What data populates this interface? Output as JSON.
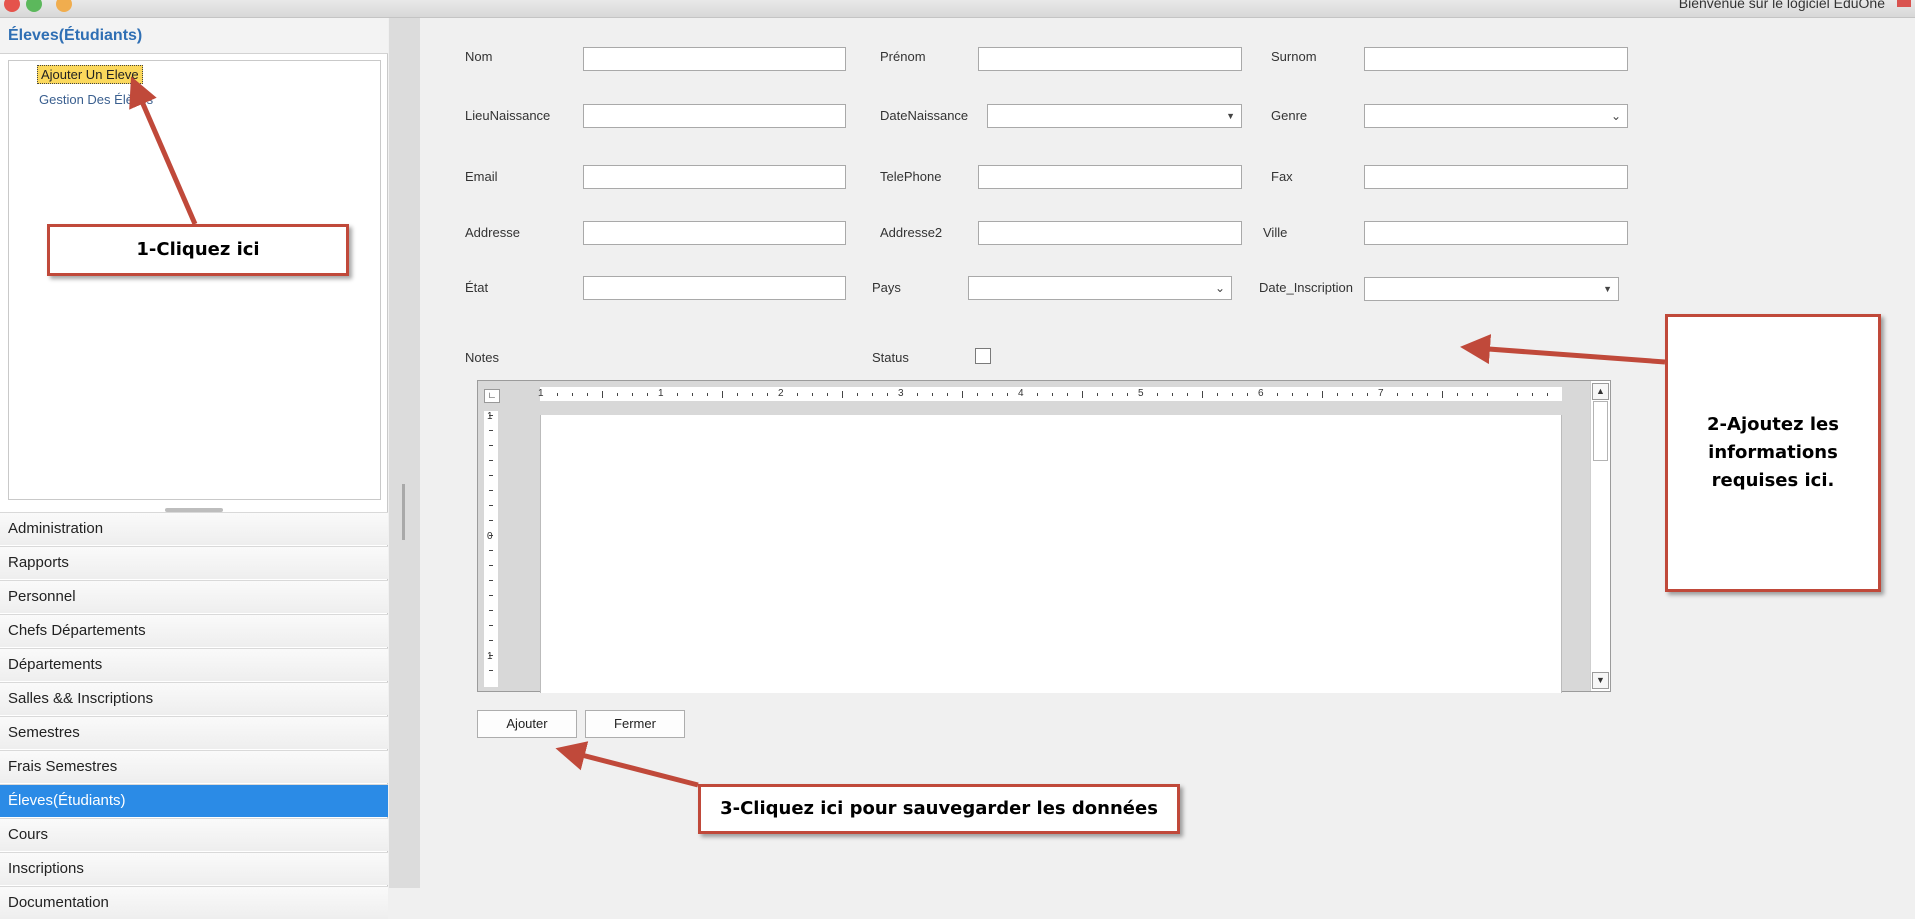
{
  "window": {
    "welcome_text": "Bienvenue sur le logiciel EduOne"
  },
  "sidebar": {
    "group_title": "Éleves(Étudiants)",
    "tree_items": [
      {
        "label": "Ajouter Un Eleve",
        "selected": true
      },
      {
        "label": "Gestion Des Élèves",
        "selected": false
      }
    ],
    "nav_items": [
      {
        "label": "Administration"
      },
      {
        "label": "Rapports"
      },
      {
        "label": "Personnel"
      },
      {
        "label": "Chefs Départements"
      },
      {
        "label": "Départements"
      },
      {
        "label": "Salles && Inscriptions"
      },
      {
        "label": "Semestres"
      },
      {
        "label": "Frais Semestres"
      },
      {
        "label": "Éleves(Étudiants)",
        "active": true
      },
      {
        "label": "Cours"
      },
      {
        "label": "Inscriptions"
      },
      {
        "label": "Documentation"
      }
    ]
  },
  "form": {
    "nom": {
      "label": "Nom",
      "value": ""
    },
    "prenom": {
      "label": "Prénom",
      "value": ""
    },
    "surnom": {
      "label": "Surnom",
      "value": ""
    },
    "lieu_naissance": {
      "label": "LieuNaissance",
      "value": ""
    },
    "date_naissance": {
      "label": "DateNaissance",
      "value": ""
    },
    "genre": {
      "label": "Genre",
      "value": ""
    },
    "email": {
      "label": "Email",
      "value": ""
    },
    "telephone": {
      "label": "TelePhone",
      "value": ""
    },
    "fax": {
      "label": "Fax",
      "value": ""
    },
    "addresse": {
      "label": "Addresse",
      "value": ""
    },
    "addresse2": {
      "label": "Addresse2",
      "value": ""
    },
    "ville": {
      "label": "Ville",
      "value": ""
    },
    "etat": {
      "label": "État",
      "value": ""
    },
    "pays": {
      "label": "Pays",
      "value": ""
    },
    "date_inscription": {
      "label": "Date_Inscription",
      "value": ""
    },
    "notes": {
      "label": "Notes"
    },
    "status": {
      "label": "Status",
      "checked": false
    }
  },
  "editor": {
    "ruler_numbers": [
      "1",
      "1",
      "2",
      "3",
      "4",
      "5",
      "6",
      "7"
    ],
    "vruler_numbers": [
      "1",
      "0",
      "1"
    ]
  },
  "buttons": {
    "ajouter": "Ajouter",
    "fermer": "Fermer"
  },
  "annotations": {
    "step1": "1-Cliquez ici",
    "step2": "2-Ajoutez les informations requises ici.",
    "step3": "3-Cliquez ici pour sauvegarder les données"
  },
  "colors": {
    "accent": "#2b8be6",
    "selection": "#fbd85c",
    "callout_border": "#c0493a",
    "group_title": "#2f6fb4"
  }
}
